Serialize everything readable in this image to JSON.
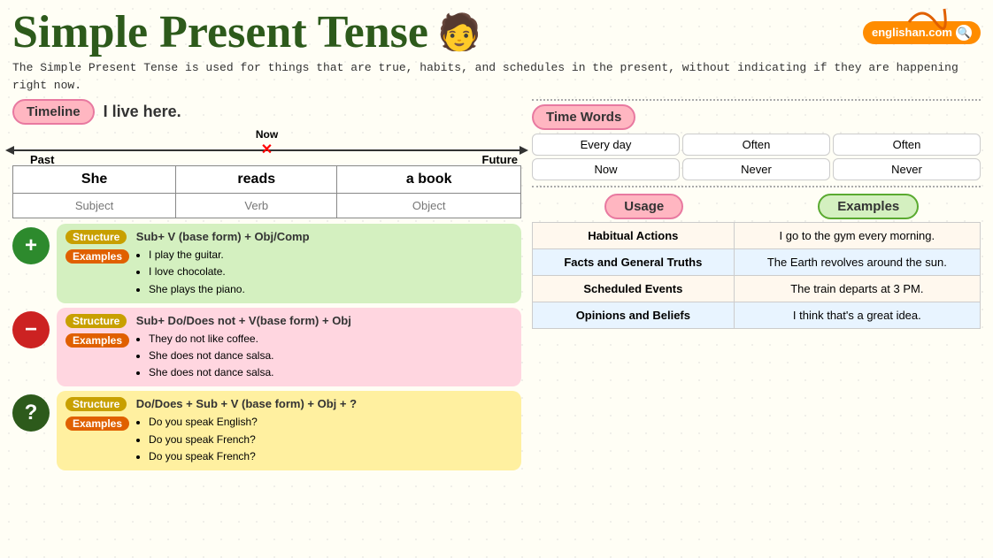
{
  "page": {
    "title": "Simple Present Tense",
    "subtitle": "The Simple Present Tense is used for things that are true, habits, and schedules in the present, without indicating if they are happening right now.",
    "brand": "englishan.com",
    "timeline": {
      "label": "Timeline",
      "text": "I live here.",
      "past": "Past",
      "now": "Now",
      "future": "Future"
    },
    "sentence_table": {
      "headers": [
        "She",
        "reads",
        "a book"
      ],
      "labels": [
        "Subject",
        "Verb",
        "Object"
      ]
    },
    "structures": [
      {
        "type": "positive",
        "icon": "+",
        "structure_label": "Structure",
        "formula": "Sub+ V (base form) + Obj/Comp",
        "examples_label": "Examples",
        "examples": [
          "I play the guitar.",
          "I love chocolate.",
          "She plays the piano."
        ],
        "color": "green"
      },
      {
        "type": "negative",
        "icon": "−",
        "structure_label": "Structure",
        "formula": "Sub+ Do/Does not + V(base form) + Obj",
        "examples_label": "Examples",
        "examples": [
          "They do not like coffee.",
          "She does not dance salsa.",
          "She does not dance salsa."
        ],
        "color": "pink"
      },
      {
        "type": "question",
        "icon": "?",
        "structure_label": "Structure",
        "formula": "Do/Does + Sub + V (base form) + Obj + ?",
        "examples_label": "Examples",
        "examples": [
          "Do you speak English?",
          "Do you speak French?",
          "Do you speak French?"
        ],
        "color": "yellow"
      }
    ],
    "time_words": {
      "title": "Time Words",
      "words": [
        "Every day",
        "Often",
        "Often",
        "Now",
        "Never",
        "Never"
      ]
    },
    "usage_examples": {
      "usage_label": "Usage",
      "examples_label": "Examples",
      "rows": [
        {
          "usage": "Habitual Actions",
          "example": "I go to the gym every morning."
        },
        {
          "usage": "Facts and General Truths",
          "example": "The Earth revolves around the sun."
        },
        {
          "usage": "Scheduled Events",
          "example": "The train departs at 3 PM."
        },
        {
          "usage": "Opinions and Beliefs",
          "example": "I think that's a great idea."
        }
      ]
    }
  }
}
